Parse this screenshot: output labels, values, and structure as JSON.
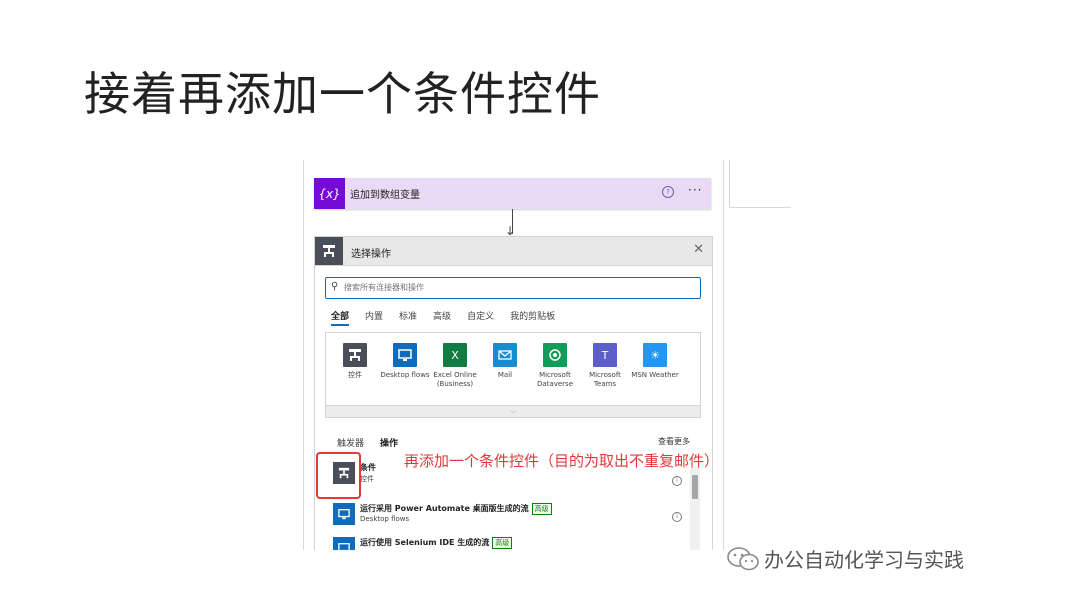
{
  "slide": {
    "title": "接着再添加一个条件控件"
  },
  "var_step": {
    "icon_text": "{x}",
    "title": "追加到数组变量",
    "help_icon": "question-circle-icon",
    "more": "···"
  },
  "panel": {
    "title": "选择操作",
    "close": "✕",
    "search": {
      "placeholder": "搜索所有连接器和操作"
    },
    "tabs": [
      "全部",
      "内置",
      "标准",
      "高级",
      "自定义",
      "我的剪贴板"
    ],
    "connectors": [
      {
        "name": "控件",
        "color": "#484f58",
        "icon": "control-icon"
      },
      {
        "name": "Desktop flows",
        "color": "#0f6cbd",
        "icon": "desktop-icon"
      },
      {
        "name": "Excel Online (Business)",
        "color": "#107c41",
        "icon": "excel-icon"
      },
      {
        "name": "Mail",
        "color": "#1a8bcf",
        "icon": "mail-icon"
      },
      {
        "name": "Microsoft Dataverse",
        "color": "#0f9d58",
        "icon": "dataverse-icon"
      },
      {
        "name": "Microsoft Teams",
        "color": "#5b5fc7",
        "icon": "teams-icon"
      },
      {
        "name": "MSN Weather",
        "color": "#2196f3",
        "icon": "weather-icon"
      }
    ],
    "expander": "⌵",
    "sub_tabs": [
      "触发器",
      "操作"
    ],
    "see_more": "查看更多",
    "results": [
      {
        "title": "条件",
        "subtitle": "控件",
        "color": "#484f58",
        "premium": ""
      },
      {
        "title": "运行采用 Power Automate 桌面版生成的流",
        "subtitle": "Desktop flows",
        "color": "#0f6cbd",
        "premium": "高级"
      },
      {
        "title": "运行使用 Selenium IDE 生成的流",
        "subtitle": "",
        "color": "#0f6cbd",
        "premium": "高级"
      }
    ]
  },
  "annotation": "再添加一个条件控件（目的为取出不重复邮件）",
  "watermark": "办公自动化学习与实践"
}
